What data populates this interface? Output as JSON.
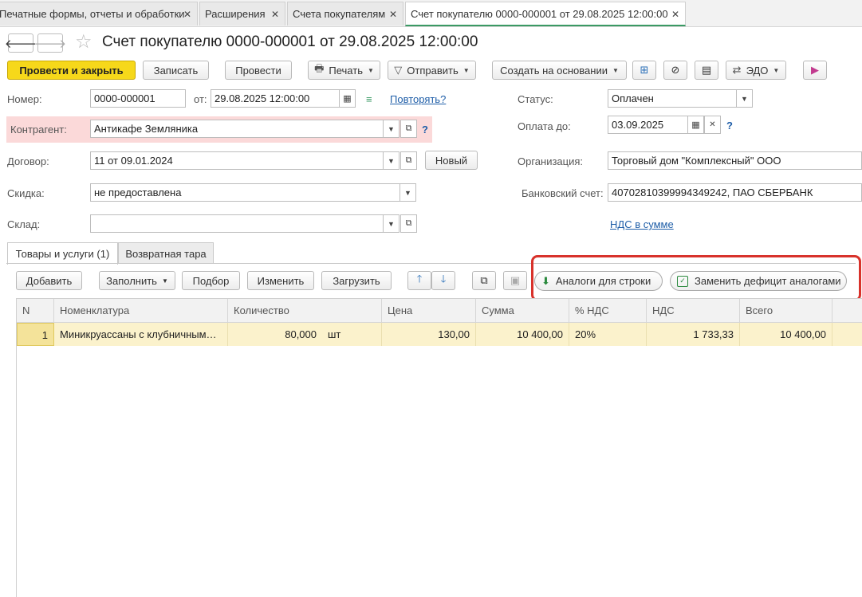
{
  "tabs": [
    {
      "label": "Печатные формы, отчеты и обработки"
    },
    {
      "label": "Расширения"
    },
    {
      "label": "Счета покупателям"
    },
    {
      "label": "Счет покупателю 0000-000001 от 29.08.2025 12:00:00"
    }
  ],
  "title": "Счет покупателю 0000-000001 от 29.08.2025 12:00:00",
  "toolbar": {
    "post_close": "Провести и закрыть",
    "save": "Записать",
    "post": "Провести",
    "print": "Печать",
    "send": "Отправить",
    "create_based": "Создать на основании",
    "edo": "ЭДО"
  },
  "form": {
    "number_label": "Номер:",
    "number_value": "0000-000001",
    "date_label": "от:",
    "date_value": "29.08.2025 12:00:00",
    "repeat_link": "Повторять?",
    "status_label": "Статус:",
    "status_value": "Оплачен",
    "counterparty_label": "Контрагент:",
    "counterparty_value": "Антикафе Земляника",
    "pay_until_label": "Оплата до:",
    "pay_until_value": "03.09.2025",
    "contract_label": "Договор:",
    "contract_value": "11 от 09.01.2024",
    "new_button": "Новый",
    "org_label": "Организация:",
    "org_value": "Торговый дом \"Комплексный\" ООО",
    "discount_label": "Скидка:",
    "discount_value": "не предоставлена",
    "bank_label": "Банковский счет:",
    "bank_value": "40702810399994349242, ПАО СБЕРБАНК",
    "warehouse_label": "Склад:",
    "warehouse_value": "",
    "vat_link": "НДС в сумме"
  },
  "inner_tabs": {
    "goods": "Товары и услуги (1)",
    "returnable": "Возвратная тара"
  },
  "table_toolbar": {
    "add": "Добавить",
    "fill": "Заполнить",
    "pick": "Подбор",
    "edit": "Изменить",
    "load": "Загрузить",
    "analogs_row": "Аналоги для строки",
    "replace_deficit": "Заменить дефицит аналогами"
  },
  "grid": {
    "headers": {
      "n": "N",
      "item": "Номенклатура",
      "qty": "Количество",
      "price": "Цена",
      "sum": "Сумма",
      "vat_rate": "% НДС",
      "vat": "НДС",
      "total": "Всего"
    },
    "rows": [
      {
        "n": "1",
        "item": "Миникруассаны с клубничным…",
        "qty": "80,000",
        "unit": "шт",
        "price": "130,00",
        "sum": "10 400,00",
        "vat_rate": "20%",
        "vat": "1 733,33",
        "total": "10 400,00"
      }
    ]
  }
}
